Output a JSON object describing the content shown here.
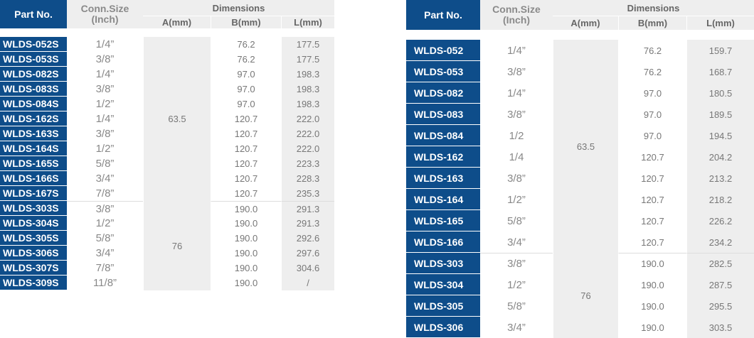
{
  "tables": [
    {
      "id": "left",
      "header": {
        "part_no": "Part No.",
        "conn_size_line1": "Conn.Size",
        "conn_size_line2": "(Inch)",
        "dimensions": "Dimensions",
        "a": "A(mm)",
        "b": "B(mm)",
        "l": "L(mm)"
      },
      "groups": [
        {
          "a_value": "63.5",
          "rows": [
            {
              "part": "WLDS-052S",
              "conn": "1/4”",
              "b": "76.2",
              "l": "177.5"
            },
            {
              "part": "WLDS-053S",
              "conn": "3/8”",
              "b": "76.2",
              "l": "177.5"
            },
            {
              "part": "WLDS-082S",
              "conn": "1/4”",
              "b": "97.0",
              "l": "198.3"
            },
            {
              "part": "WLDS-083S",
              "conn": "3/8”",
              "b": "97.0",
              "l": "198.3"
            },
            {
              "part": "WLDS-084S",
              "conn": "1/2”",
              "b": "97.0",
              "l": "198.3"
            },
            {
              "part": "WLDS-162S",
              "conn": "1/4”",
              "b": "120.7",
              "l": "222.0"
            },
            {
              "part": "WLDS-163S",
              "conn": "3/8”",
              "b": "120.7",
              "l": "222.0"
            },
            {
              "part": "WLDS-164S",
              "conn": "1/2”",
              "b": "120.7",
              "l": "222.0"
            },
            {
              "part": "WLDS-165S",
              "conn": "5/8”",
              "b": "120.7",
              "l": "223.3"
            },
            {
              "part": "WLDS-166S",
              "conn": "3/4”",
              "b": "120.7",
              "l": "228.3"
            },
            {
              "part": "WLDS-167S",
              "conn": "7/8”",
              "b": "120.7",
              "l": "235.3"
            }
          ]
        },
        {
          "a_value": "76",
          "rows": [
            {
              "part": "WLDS-303S",
              "conn": "3/8”",
              "b": "190.0",
              "l": "291.3"
            },
            {
              "part": "WLDS-304S",
              "conn": "1/2”",
              "b": "190.0",
              "l": "291.3"
            },
            {
              "part": "WLDS-305S",
              "conn": "5/8”",
              "b": "190.0",
              "l": "292.6"
            },
            {
              "part": "WLDS-306S",
              "conn": "3/4”",
              "b": "190.0",
              "l": "297.6"
            },
            {
              "part": "WLDS-307S",
              "conn": "7/8”",
              "b": "190.0",
              "l": "304.6"
            },
            {
              "part": "WLDS-309S",
              "conn": "11/8”",
              "b": "190.0",
              "l": "/"
            }
          ]
        }
      ]
    },
    {
      "id": "right",
      "header": {
        "part_no": "Part No.",
        "conn_size_line1": "Conn.Size",
        "conn_size_line2": "(Inch)",
        "dimensions": "Dimensions",
        "a": "A(mm)",
        "b": "B(mm)",
        "l": "L(mm)"
      },
      "groups": [
        {
          "a_value": "63.5",
          "rows": [
            {
              "part": "WLDS-052",
              "conn": "1/4”",
              "b": "76.2",
              "l": "159.7"
            },
            {
              "part": "WLDS-053",
              "conn": "3/8”",
              "b": "76.2",
              "l": "168.7"
            },
            {
              "part": "WLDS-082",
              "conn": "1/4”",
              "b": "97.0",
              "l": "180.5"
            },
            {
              "part": "WLDS-083",
              "conn": "3/8”",
              "b": "97.0",
              "l": "189.5"
            },
            {
              "part": "WLDS-084",
              "conn": "1/2",
              "b": "97.0",
              "l": "194.5"
            },
            {
              "part": "WLDS-162",
              "conn": "1/4",
              "b": "120.7",
              "l": "204.2"
            },
            {
              "part": "WLDS-163",
              "conn": "3/8”",
              "b": "120.7",
              "l": "213.2"
            },
            {
              "part": "WLDS-164",
              "conn": "1/2”",
              "b": "120.7",
              "l": "218.2"
            },
            {
              "part": "WLDS-165",
              "conn": "5/8”",
              "b": "120.7",
              "l": "226.2"
            },
            {
              "part": "WLDS-166",
              "conn": "3/4”",
              "b": "120.7",
              "l": "234.2"
            }
          ]
        },
        {
          "a_value": "76",
          "rows": [
            {
              "part": "WLDS-303",
              "conn": "3/8”",
              "b": "190.0",
              "l": "282.5"
            },
            {
              "part": "WLDS-304",
              "conn": "1/2”",
              "b": "190.0",
              "l": "287.5"
            },
            {
              "part": "WLDS-305",
              "conn": "5/8”",
              "b": "190.0",
              "l": "295.5"
            },
            {
              "part": "WLDS-306",
              "conn": "3/4”",
              "b": "190.0",
              "l": "303.5"
            }
          ]
        }
      ]
    }
  ]
}
